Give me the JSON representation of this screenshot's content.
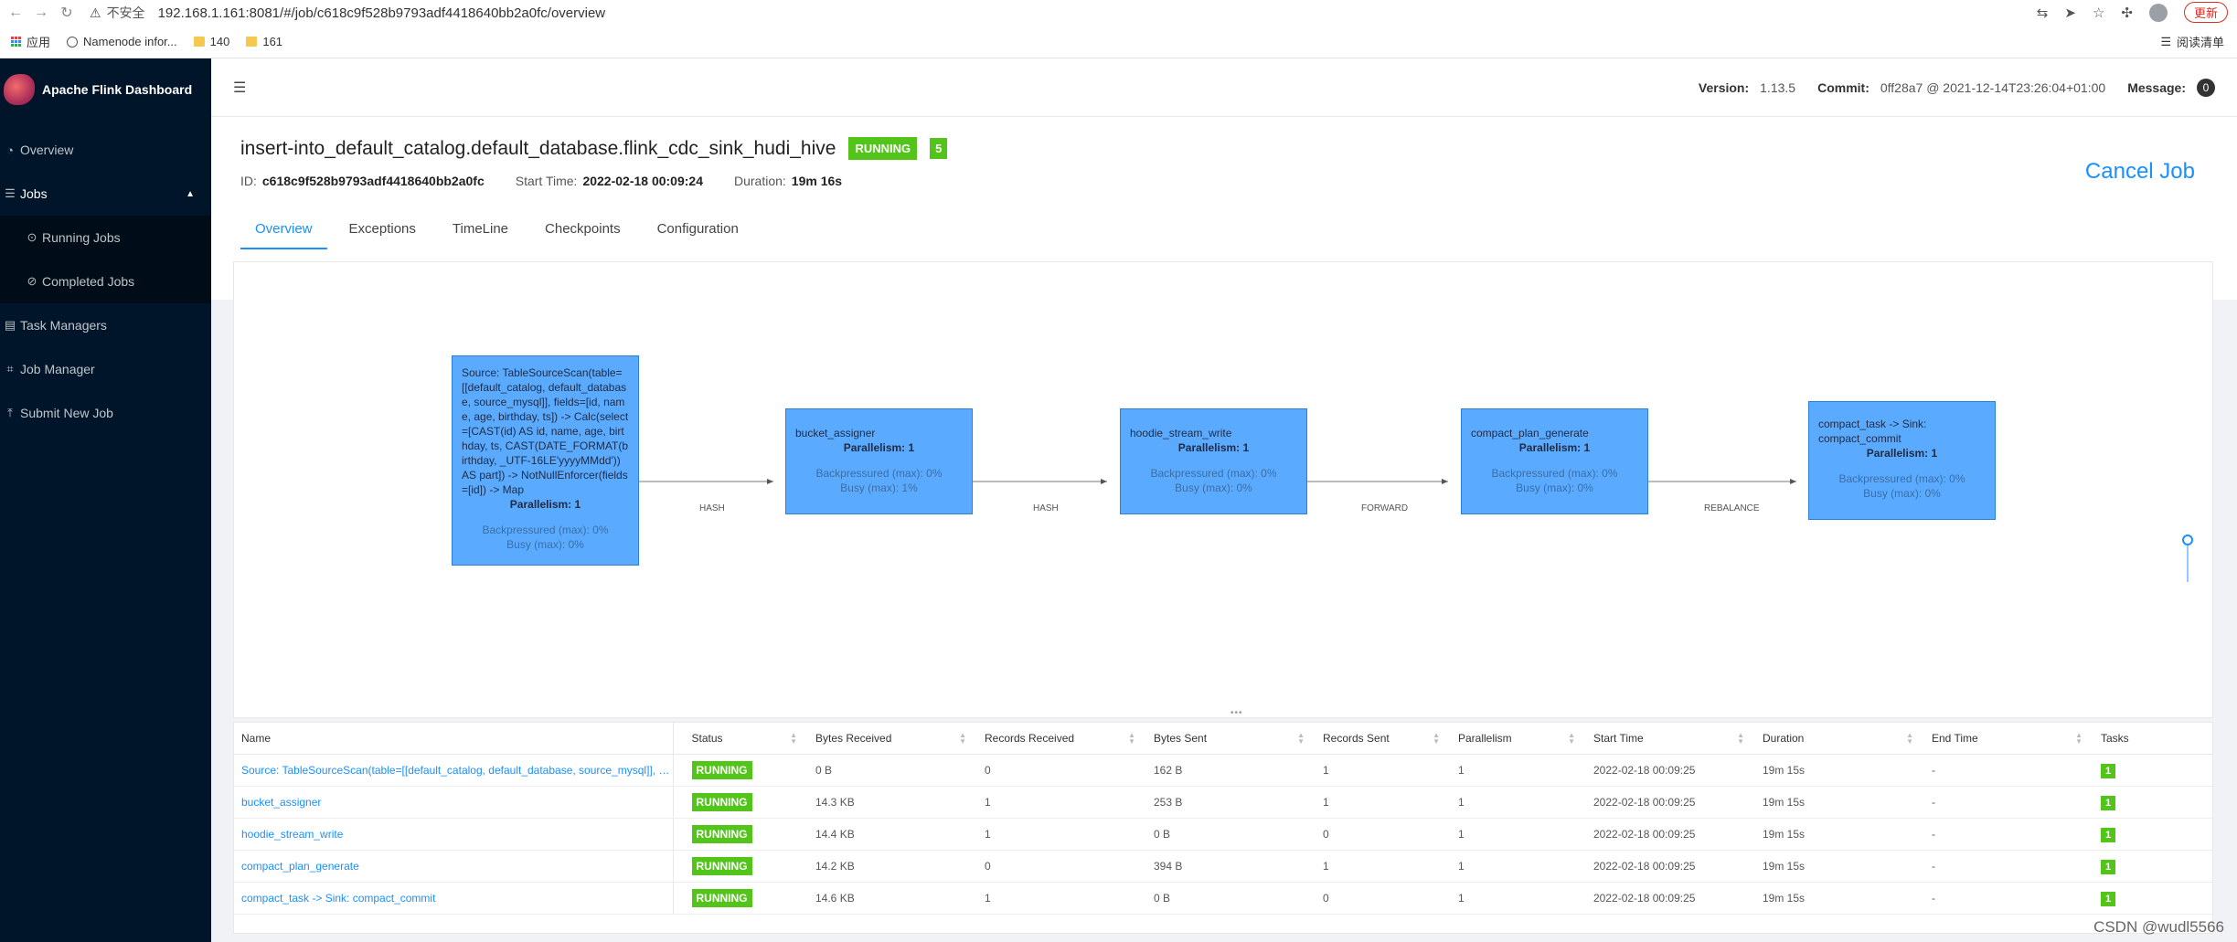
{
  "browser": {
    "insecure": "不安全",
    "url": "192.168.1.161:8081/#/job/c618c9f528b9793adf4418640bb2a0fc/overview",
    "update_label": "更新",
    "bookmarks": [
      "应用",
      "Namenode infor...",
      "140",
      "161"
    ],
    "reading_list": "阅读清单"
  },
  "sidebar": {
    "app_title": "Apache Flink Dashboard",
    "items": [
      {
        "label": "Overview",
        "icon": "dashboard-icon"
      },
      {
        "label": "Jobs",
        "icon": "jobs-icon"
      },
      {
        "label": "Running Jobs",
        "icon": "play-circle-icon"
      },
      {
        "label": "Completed Jobs",
        "icon": "check-circle-icon"
      },
      {
        "label": "Task Managers",
        "icon": "task-managers-icon"
      },
      {
        "label": "Job Manager",
        "icon": "job-manager-icon"
      },
      {
        "label": "Submit New Job",
        "icon": "upload-icon"
      }
    ]
  },
  "header": {
    "version_label": "Version:",
    "version": "1.13.5",
    "commit_label": "Commit:",
    "commit": "0ff28a7 @ 2021-12-14T23:26:04+01:00",
    "message_label": "Message:",
    "message_count": "0"
  },
  "job": {
    "name": "insert-into_default_catalog.default_database.flink_cdc_sink_hudi_hive",
    "status": "RUNNING",
    "task_count": "5",
    "id_label": "ID:",
    "id": "c618c9f528b9793adf4418640bb2a0fc",
    "start_label": "Start Time:",
    "start_time": "2022-02-18 00:09:24",
    "duration_label": "Duration:",
    "duration": "19m 16s",
    "cancel_label": "Cancel Job",
    "tabs": [
      "Overview",
      "Exceptions",
      "TimeLine",
      "Checkpoints",
      "Configuration"
    ]
  },
  "graph": {
    "nodes": [
      {
        "name": "Source: TableSourceScan(table=[[default_catalog, default_database, source_mysql]], fields=[id, name, age, birthday, ts]) -> Calc(select=[CAST(id) AS id, name, age, birthday, ts, CAST(DATE_FORMAT(birthday, _UTF-16LE'yyyyMMdd')) AS part]) -> NotNullEnforcer(fields=[id]) -> Map",
        "parallelism": "Parallelism: 1",
        "backpressured": "Backpressured (max): 0%",
        "busy": "Busy (max): 0%"
      },
      {
        "name": "bucket_assigner",
        "parallelism": "Parallelism: 1",
        "backpressured": "Backpressured (max): 0%",
        "busy": "Busy (max): 1%"
      },
      {
        "name": "hoodie_stream_write",
        "parallelism": "Parallelism: 1",
        "backpressured": "Backpressured (max): 0%",
        "busy": "Busy (max): 0%"
      },
      {
        "name": "compact_plan_generate",
        "parallelism": "Parallelism: 1",
        "backpressured": "Backpressured (max): 0%",
        "busy": "Busy (max): 0%"
      },
      {
        "name": "compact_task -> Sink: compact_commit",
        "parallelism": "Parallelism: 1",
        "backpressured": "Backpressured (max): 0%",
        "busy": "Busy (max): 0%"
      }
    ],
    "edges": [
      "HASH",
      "HASH",
      "FORWARD",
      "REBALANCE"
    ]
  },
  "table": {
    "columns": [
      "Name",
      "Status",
      "Bytes Received",
      "Records Received",
      "Bytes Sent",
      "Records Sent",
      "Parallelism",
      "Start Time",
      "Duration",
      "End Time",
      "Tasks"
    ],
    "rows": [
      [
        "Source: TableSourceScan(table=[[default_catalog, default_database, source_mysql]], fiel...",
        "RUNNING",
        "0 B",
        "0",
        "162 B",
        "1",
        "1",
        "2022-02-18 00:09:25",
        "19m 15s",
        "-",
        "1"
      ],
      [
        "bucket_assigner",
        "RUNNING",
        "14.3 KB",
        "1",
        "253 B",
        "1",
        "1",
        "2022-02-18 00:09:25",
        "19m 15s",
        "-",
        "1"
      ],
      [
        "hoodie_stream_write",
        "RUNNING",
        "14.4 KB",
        "1",
        "0 B",
        "0",
        "1",
        "2022-02-18 00:09:25",
        "19m 15s",
        "-",
        "1"
      ],
      [
        "compact_plan_generate",
        "RUNNING",
        "14.2 KB",
        "0",
        "394 B",
        "1",
        "1",
        "2022-02-18 00:09:25",
        "19m 15s",
        "-",
        "1"
      ],
      [
        "compact_task -> Sink: compact_commit",
        "RUNNING",
        "14.6 KB",
        "1",
        "0 B",
        "0",
        "1",
        "2022-02-18 00:09:25",
        "19m 15s",
        "-",
        "1"
      ]
    ]
  },
  "watermark": "CSDN @wudl5566",
  "colors": {
    "sidebar": "#001529",
    "accent": "#1890ff",
    "running": "#52c41a",
    "node": "#5aabff"
  }
}
